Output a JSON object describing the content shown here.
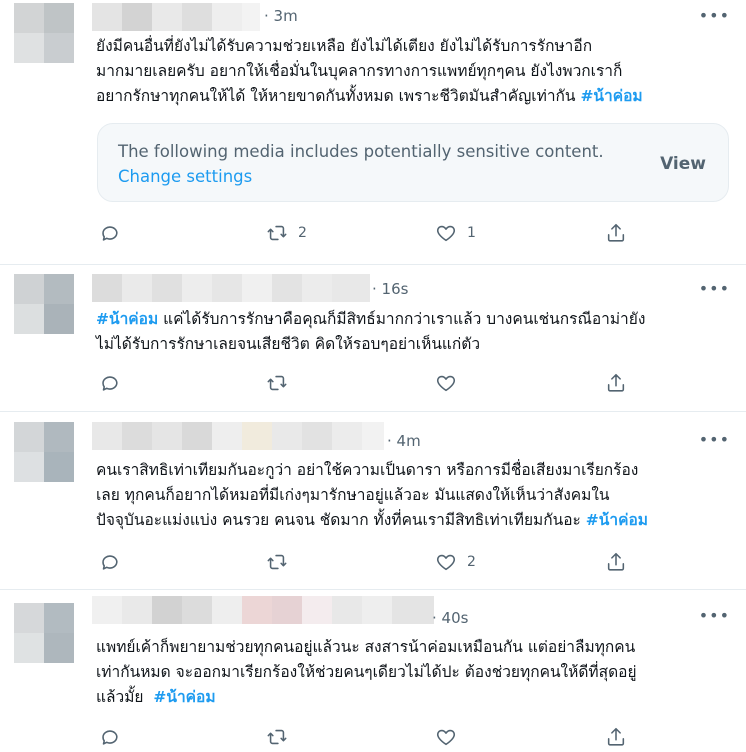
{
  "more_label": "•••",
  "tweets": [
    {
      "time": "· 3m",
      "lines": [
        "ยังมีคนอื่นที่ยังไม่ได้รับความช่วยเหลือ ยังไม่ได้เตียง ยังไม่ได้รับการรักษาอีก",
        "มากมายเลยครับ อยากให้เชื่อมั่นในบุคลากรทางการแพทย์ทุกๆคน ยังไงพวกเราก็",
        "อยากรักษาทุกคนให้ได้ ให้หายขาดกันทั้งหมด เพราะชีวิตมันสำคัญเท่ากัน "
      ],
      "hashtag": "#น้าค่อม",
      "media": {
        "message": "The following media includes potentially sensitive content.",
        "change_settings": "Change settings",
        "view": "View"
      },
      "retweets": "2",
      "likes": "1"
    },
    {
      "time": "· 16s",
      "lines": [
        " แค่ได้รับการรักษาคือคุณก็มีสิทธ์มากกว่าเราแล้ว บางคนเช่นกรณีอาม่ายัง",
        "ไม่ได้รับการรักษาเลยจนเสียชีวิต คิดให้รอบๆอย่าเห็นแก่ตัว"
      ],
      "hashtag": "#น้าค่อม",
      "retweets": "",
      "likes": ""
    },
    {
      "time": "· 4m",
      "lines": [
        "คนเราสิทธิเท่าเทียมกันอะกูว่า อย่าใช้ความเป็นดารา หรือการมีชื่อเสียงมาเรียกร้อง",
        "เลย ทุกคนก็อยากได้หมอที่มีเก่งๆมารักษาอยู่แล้วอะ มันแสดงให้เห็นว่าสังคมใน",
        "ปัจจุบันอะแม่งแบ่ง คนรวย คนจน ชัดมาก ทั้งที่คนเรามีสิทธิเท่าเทียมกันอะ "
      ],
      "hashtag": "#น้าค่อม",
      "retweets": "",
      "likes": "2"
    },
    {
      "time": "· 40s",
      "lines": [
        "แพทย์เค้าก็พยายามช่วยทุกคนอยู่แล้วนะ สงสารน้าค่อมเหมือนกัน แต่อย่าลืมทุกคน",
        "เท่ากันหมด จะออกมาเรียกร้องให้ช่วยคนๆเดียวไม่ได้ปะ ต้องช่วยทุกคนให้ดีที่สุดอยู่",
        "แล้วมั้ย  "
      ],
      "hashtag": "#น้าค่อม",
      "retweets": "",
      "likes": ""
    }
  ]
}
